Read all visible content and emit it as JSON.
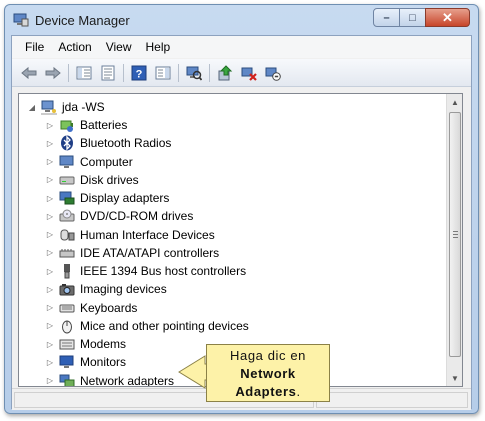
{
  "window": {
    "title": "Device Manager"
  },
  "menu": [
    "File",
    "Action",
    "View",
    "Help"
  ],
  "toolbar": [
    "back-icon",
    "forward-icon",
    "show-hide-tree-icon",
    "properties-icon",
    "help-icon",
    "action-pane-icon",
    "scan-hardware-icon",
    "update-driver-icon",
    "uninstall-icon",
    "disable-icon"
  ],
  "tree": {
    "root": "jda -WS",
    "items": [
      {
        "label": "Batteries",
        "icon": "battery-icon"
      },
      {
        "label": "Bluetooth Radios",
        "icon": "bluetooth-icon"
      },
      {
        "label": "Computer",
        "icon": "computer-icon"
      },
      {
        "label": "Disk drives",
        "icon": "disk-drive-icon"
      },
      {
        "label": "Display adapters",
        "icon": "display-adapter-icon"
      },
      {
        "label": "DVD/CD-ROM drives",
        "icon": "dvd-drive-icon"
      },
      {
        "label": "Human Interface Devices",
        "icon": "hid-icon"
      },
      {
        "label": "IDE ATA/ATAPI controllers",
        "icon": "ide-controller-icon"
      },
      {
        "label": "IEEE 1394 Bus host controllers",
        "icon": "ieee1394-icon"
      },
      {
        "label": "Imaging devices",
        "icon": "camera-icon"
      },
      {
        "label": "Keyboards",
        "icon": "keyboard-icon"
      },
      {
        "label": "Mice and other pointing devices",
        "icon": "mouse-icon"
      },
      {
        "label": "Modems",
        "icon": "modem-icon"
      },
      {
        "label": "Monitors",
        "icon": "monitor-icon"
      },
      {
        "label": "Network adapters",
        "icon": "network-adapter-icon"
      }
    ]
  },
  "callout": {
    "line1": "Haga dic en",
    "line2": "Network",
    "line3": "Adapters",
    "line3_suffix": "."
  },
  "colors": {
    "callout_bg": "#fdf2a8",
    "title_bar": "#c7daf0",
    "close_button": "#c7452a"
  }
}
